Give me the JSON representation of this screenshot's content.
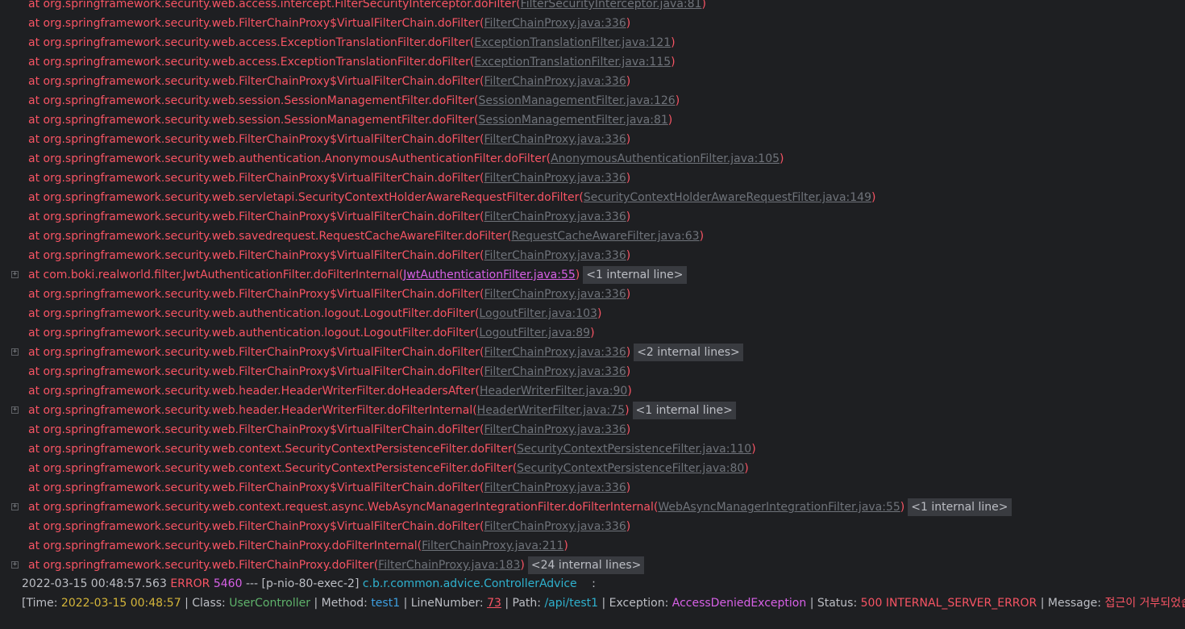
{
  "trace": [
    {
      "text": "at org.springframework.security.web.access.intercept.FilterSecurityInterceptor.doFilter(",
      "link": "FilterSecurityInterceptor.java:81",
      "close": ")",
      "fold": false,
      "internal": "",
      "user": false
    },
    {
      "text": "at org.springframework.security.web.FilterChainProxy$VirtualFilterChain.doFilter(",
      "link": "FilterChainProxy.java:336",
      "close": ")",
      "fold": false,
      "internal": "",
      "user": false
    },
    {
      "text": "at org.springframework.security.web.access.ExceptionTranslationFilter.doFilter(",
      "link": "ExceptionTranslationFilter.java:121",
      "close": ")",
      "fold": false,
      "internal": "",
      "user": false
    },
    {
      "text": "at org.springframework.security.web.access.ExceptionTranslationFilter.doFilter(",
      "link": "ExceptionTranslationFilter.java:115",
      "close": ")",
      "fold": false,
      "internal": "",
      "user": false
    },
    {
      "text": "at org.springframework.security.web.FilterChainProxy$VirtualFilterChain.doFilter(",
      "link": "FilterChainProxy.java:336",
      "close": ")",
      "fold": false,
      "internal": "",
      "user": false
    },
    {
      "text": "at org.springframework.security.web.session.SessionManagementFilter.doFilter(",
      "link": "SessionManagementFilter.java:126",
      "close": ")",
      "fold": false,
      "internal": "",
      "user": false
    },
    {
      "text": "at org.springframework.security.web.session.SessionManagementFilter.doFilter(",
      "link": "SessionManagementFilter.java:81",
      "close": ")",
      "fold": false,
      "internal": "",
      "user": false
    },
    {
      "text": "at org.springframework.security.web.FilterChainProxy$VirtualFilterChain.doFilter(",
      "link": "FilterChainProxy.java:336",
      "close": ")",
      "fold": false,
      "internal": "",
      "user": false
    },
    {
      "text": "at org.springframework.security.web.authentication.AnonymousAuthenticationFilter.doFilter(",
      "link": "AnonymousAuthenticationFilter.java:105",
      "close": ")",
      "fold": false,
      "internal": "",
      "user": false
    },
    {
      "text": "at org.springframework.security.web.FilterChainProxy$VirtualFilterChain.doFilter(",
      "link": "FilterChainProxy.java:336",
      "close": ")",
      "fold": false,
      "internal": "",
      "user": false
    },
    {
      "text": "at org.springframework.security.web.servletapi.SecurityContextHolderAwareRequestFilter.doFilter(",
      "link": "SecurityContextHolderAwareRequestFilter.java:149",
      "close": ")",
      "fold": false,
      "internal": "",
      "user": false
    },
    {
      "text": "at org.springframework.security.web.FilterChainProxy$VirtualFilterChain.doFilter(",
      "link": "FilterChainProxy.java:336",
      "close": ")",
      "fold": false,
      "internal": "",
      "user": false
    },
    {
      "text": "at org.springframework.security.web.savedrequest.RequestCacheAwareFilter.doFilter(",
      "link": "RequestCacheAwareFilter.java:63",
      "close": ")",
      "fold": false,
      "internal": "",
      "user": false
    },
    {
      "text": "at org.springframework.security.web.FilterChainProxy$VirtualFilterChain.doFilter(",
      "link": "FilterChainProxy.java:336",
      "close": ")",
      "fold": false,
      "internal": "",
      "user": false
    },
    {
      "text": "at com.boki.realworld.filter.JwtAuthenticationFilter.doFilterInternal(",
      "link": "JwtAuthenticationFilter.java:55",
      "close": ")",
      "fold": true,
      "internal": "<1 internal line>",
      "user": true
    },
    {
      "text": "at org.springframework.security.web.FilterChainProxy$VirtualFilterChain.doFilter(",
      "link": "FilterChainProxy.java:336",
      "close": ")",
      "fold": false,
      "internal": "",
      "user": false
    },
    {
      "text": "at org.springframework.security.web.authentication.logout.LogoutFilter.doFilter(",
      "link": "LogoutFilter.java:103",
      "close": ")",
      "fold": false,
      "internal": "",
      "user": false
    },
    {
      "text": "at org.springframework.security.web.authentication.logout.LogoutFilter.doFilter(",
      "link": "LogoutFilter.java:89",
      "close": ")",
      "fold": false,
      "internal": "",
      "user": false
    },
    {
      "text": "at org.springframework.security.web.FilterChainProxy$VirtualFilterChain.doFilter(",
      "link": "FilterChainProxy.java:336",
      "close": ")",
      "fold": true,
      "internal": "<2 internal lines>",
      "user": false
    },
    {
      "text": "at org.springframework.security.web.FilterChainProxy$VirtualFilterChain.doFilter(",
      "link": "FilterChainProxy.java:336",
      "close": ")",
      "fold": false,
      "internal": "",
      "user": false
    },
    {
      "text": "at org.springframework.security.web.header.HeaderWriterFilter.doHeadersAfter(",
      "link": "HeaderWriterFilter.java:90",
      "close": ")",
      "fold": false,
      "internal": "",
      "user": false
    },
    {
      "text": "at org.springframework.security.web.header.HeaderWriterFilter.doFilterInternal(",
      "link": "HeaderWriterFilter.java:75",
      "close": ")",
      "fold": true,
      "internal": "<1 internal line>",
      "user": false
    },
    {
      "text": "at org.springframework.security.web.FilterChainProxy$VirtualFilterChain.doFilter(",
      "link": "FilterChainProxy.java:336",
      "close": ")",
      "fold": false,
      "internal": "",
      "user": false
    },
    {
      "text": "at org.springframework.security.web.context.SecurityContextPersistenceFilter.doFilter(",
      "link": "SecurityContextPersistenceFilter.java:110",
      "close": ")",
      "fold": false,
      "internal": "",
      "user": false
    },
    {
      "text": "at org.springframework.security.web.context.SecurityContextPersistenceFilter.doFilter(",
      "link": "SecurityContextPersistenceFilter.java:80",
      "close": ")",
      "fold": false,
      "internal": "",
      "user": false
    },
    {
      "text": "at org.springframework.security.web.FilterChainProxy$VirtualFilterChain.doFilter(",
      "link": "FilterChainProxy.java:336",
      "close": ")",
      "fold": false,
      "internal": "",
      "user": false
    },
    {
      "text": "at org.springframework.security.web.context.request.async.WebAsyncManagerIntegrationFilter.doFilterInternal(",
      "link": "WebAsyncManagerIntegrationFilter.java:55",
      "close": ")",
      "fold": true,
      "internal": "<1 internal line>",
      "user": false
    },
    {
      "text": "at org.springframework.security.web.FilterChainProxy$VirtualFilterChain.doFilter(",
      "link": "FilterChainProxy.java:336",
      "close": ")",
      "fold": false,
      "internal": "",
      "user": false
    },
    {
      "text": "at org.springframework.security.web.FilterChainProxy.doFilterInternal(",
      "link": "FilterChainProxy.java:211",
      "close": ")",
      "fold": false,
      "internal": "",
      "user": false
    },
    {
      "text": "at org.springframework.security.web.FilterChainProxy.doFilter(",
      "link": "FilterChainProxy.java:183",
      "close": ")",
      "fold": true,
      "internal": "<24 internal lines>",
      "user": false
    }
  ],
  "log": {
    "timestamp": "2022-03-15 00:48:57.563",
    "level": "ERROR",
    "pid": "5460",
    "sep": "---",
    "thread": "[p-nio-80-exec-2]",
    "logger": "c.b.r.common.advice.ControllerAdvice",
    "colon": ":"
  },
  "detail": {
    "open": "[Time:",
    "time": "2022-03-15 00:48:57",
    "class_label": "| Class:",
    "class_value": "UserController",
    "method_label": "| Method:",
    "method_value": "test1",
    "line_label": "| LineNumber:",
    "line_value": "73",
    "path_label": "| Path:",
    "path_value": "/api/test1",
    "exception_label": "| Exception:",
    "exception_value": "AccessDeniedException",
    "status_label": "| Status:",
    "status_value": "500 INTERNAL_SERVER_ERROR",
    "message_label": "| Message:",
    "message_value": "접근이 거부되었습니다.",
    "close": "]"
  },
  "colors": {
    "background": "#1e1f22",
    "error_red": "#f75464",
    "link_gray": "#6f737a",
    "user_link": "#d760e6"
  }
}
